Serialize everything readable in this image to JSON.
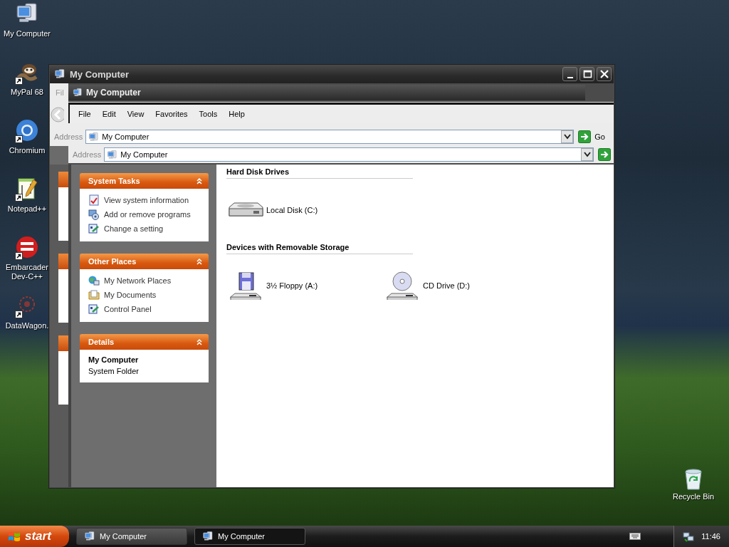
{
  "desktop": {
    "icons": [
      {
        "label": "My Computer",
        "kind": "computer",
        "shortcut": false
      },
      {
        "label": "MyPal 68",
        "kind": "raccoon",
        "shortcut": true
      },
      {
        "label": "Chromium",
        "kind": "ring",
        "shortcut": true
      },
      {
        "label": "Notepad++",
        "kind": "notepad",
        "shortcut": true
      },
      {
        "label": "Embarcader\nDev-C++",
        "kind": "badge",
        "shortcut": true
      },
      {
        "label": "DataWagon.",
        "kind": "wagon",
        "shortcut": true
      }
    ],
    "recycle_bin": {
      "label": "Recycle Bin"
    }
  },
  "back_window": {
    "title": "My Computer",
    "menu_fragment": "Fil",
    "address": {
      "label": "Address",
      "value": "My Computer",
      "go": "Go"
    }
  },
  "ghost_title": "My Computer",
  "front_window": {
    "menu": [
      "File",
      "Edit",
      "View",
      "Favorites",
      "Tools",
      "Help"
    ],
    "address": {
      "label": "Address",
      "value": "My Computer"
    },
    "task_panes": [
      {
        "title": "System Tasks",
        "items": [
          {
            "label": "View system information",
            "kind": "info"
          },
          {
            "label": "Add or remove programs",
            "kind": "programs"
          },
          {
            "label": "Change a setting",
            "kind": "setting"
          }
        ]
      },
      {
        "title": "Other Places",
        "items": [
          {
            "label": "My Network Places",
            "kind": "network"
          },
          {
            "label": "My Documents",
            "kind": "documents"
          },
          {
            "label": "Control Panel",
            "kind": "setting"
          }
        ]
      }
    ],
    "details": {
      "title": "Details",
      "name": "My Computer",
      "type": "System Folder"
    },
    "groups": [
      {
        "title": "Hard Disk Drives",
        "items": [
          {
            "label": "Local Disk (C:)",
            "kind": "disk"
          }
        ]
      },
      {
        "title": "Devices with Removable Storage",
        "items": [
          {
            "label": "3½ Floppy (A:)",
            "kind": "floppy"
          },
          {
            "label": "CD Drive (D:)",
            "kind": "cd"
          }
        ]
      }
    ]
  },
  "taskbar": {
    "start": "start",
    "tasks": [
      {
        "label": "My Computer",
        "selected": false
      },
      {
        "label": "My Computer",
        "selected": true
      }
    ],
    "clock": "11:46"
  }
}
